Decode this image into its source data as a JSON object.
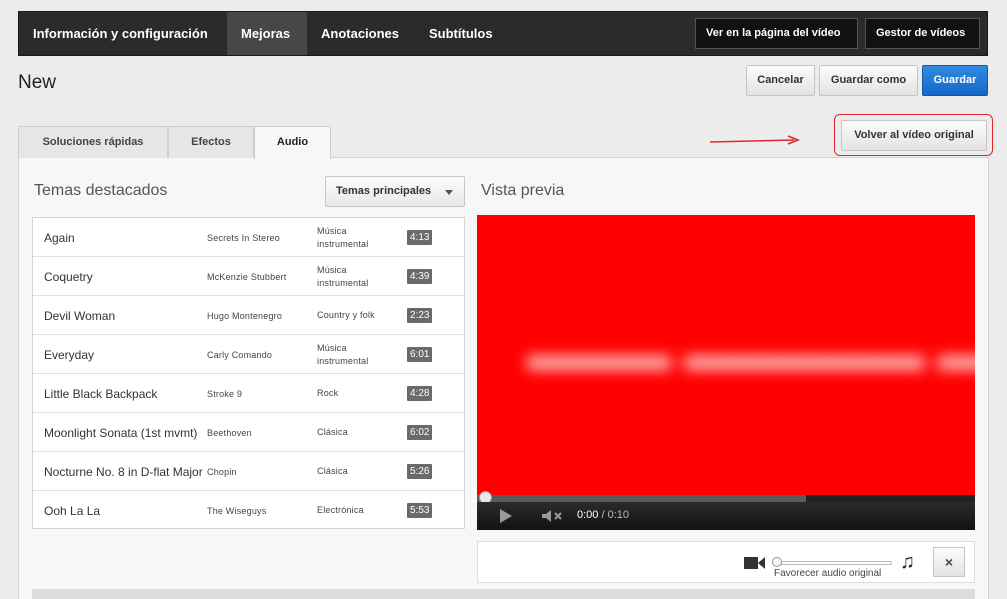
{
  "nav": {
    "tabs": [
      {
        "label": "Información y configuración",
        "active": false
      },
      {
        "label": "Mejoras",
        "active": true
      },
      {
        "label": "Anotaciones",
        "active": false
      },
      {
        "label": "Subtítulos",
        "active": false
      }
    ],
    "view_on_page": "Ver en la página del vídeo",
    "video_manager": "Gestor de vídeos"
  },
  "header": {
    "title": "New",
    "cancel": "Cancelar",
    "save_as": "Guardar como",
    "save": "Guardar"
  },
  "subtabs": [
    {
      "label": "Soluciones rápidas",
      "active": false
    },
    {
      "label": "Efectos",
      "active": false
    },
    {
      "label": "Audio",
      "active": true
    }
  ],
  "revert_button": "Volver al vídeo original",
  "featured": {
    "title": "Temas destacados",
    "dropdown": "Temas principales"
  },
  "tracks": [
    {
      "name": "Again",
      "artist": "Secrets In Stereo",
      "genre": "Música instrumental",
      "duration": "4:13"
    },
    {
      "name": "Coquetry",
      "artist": "McKenzie Stubbert",
      "genre": "Música instrumental",
      "duration": "4:39"
    },
    {
      "name": "Devil Woman",
      "artist": "Hugo Montenegro",
      "genre": "Country y folk",
      "duration": "2:23"
    },
    {
      "name": "Everyday",
      "artist": "Carly Comando",
      "genre": "Música instrumental",
      "duration": "6:01"
    },
    {
      "name": "Little Black Backpack",
      "artist": "Stroke 9",
      "genre": "Rock",
      "duration": "4:28"
    },
    {
      "name": "Moonlight Sonata (1st mvmt)",
      "artist": "Beethoven",
      "genre": "Clásica",
      "duration": "6:02"
    },
    {
      "name": "Nocturne No. 8 in D-flat Major",
      "artist": "Chopin",
      "genre": "Clásica",
      "duration": "5:26"
    },
    {
      "name": "Ooh La La",
      "artist": "The Wiseguys",
      "genre": "Electrónica",
      "duration": "5:53"
    }
  ],
  "preview": {
    "title": "Vista previa",
    "current_time": "0:00",
    "total_time": "/ 0:10",
    "loaded_fraction": 0.66,
    "playhead_fraction": 0.0
  },
  "audio_mix": {
    "label": "Favorecer audio original",
    "level_fraction": 0.0,
    "close": "×"
  },
  "colors": {
    "accent_blue": "#1768c7",
    "highlight_red": "#e0262a",
    "video_red": "#ff0000"
  }
}
